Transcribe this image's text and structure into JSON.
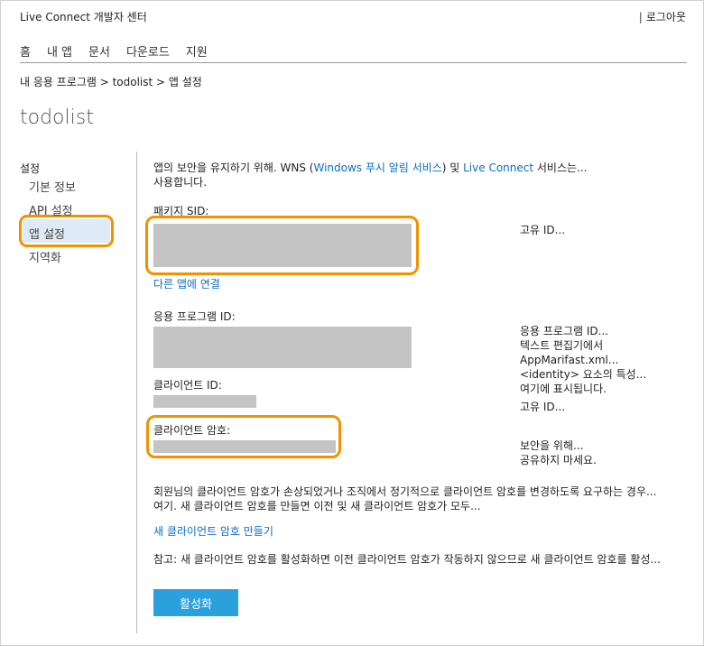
{
  "header": {
    "app_name": "Live Connect 개발자 센터",
    "separator": "|",
    "logout": "로그아웃"
  },
  "nav": [
    "홈",
    "내 앱",
    "문서",
    "다운로드",
    "지원"
  ],
  "breadcrumb": "내 응용 프로그램 > todolist > 앱 설정",
  "page_title": "todolist",
  "sidebar": {
    "heading": "설정",
    "items": [
      "기본 정보",
      "API 설정",
      "앱 설정",
      "지역화"
    ],
    "selected": "앱 설정"
  },
  "main": {
    "intro_before": "앱의 보안을 유지하기 위해. WNS (",
    "intro_link1": "Windows  푸시 알림 서비스",
    "intro_mid": ") 및 ",
    "intro_link2": "Live Connect",
    "intro_after": " 서비스는...",
    "intro_line2": "사용합니다.",
    "package_sid_label": "패키지 SID:",
    "package_sid_desc": "고유 ID...",
    "other_app_link": "다른 앱에 연결",
    "app_id_label": "응용 프로그램 ID:",
    "app_id_desc": [
      "응용 프로그램 ID...",
      "텍스트 편집기에서 AppMarifast.xml...",
      "<identity> 요소의 특성...",
      "여기에 표시됩니다."
    ],
    "client_id_label": "클라이언트 ID:",
    "client_id_desc": "고유 ID...",
    "client_secret_label": "클라이언트 암호:",
    "client_secret_desc": [
      "보안을 위해...",
      "공유하지 마세요."
    ],
    "warning_line1": "회원님의 클라이언트 암호가 손상되었거나 조직에서 정기적으로 클라이언트 암호를 변경하도록 요구하는 경우...",
    "warning_line2": "여기. 새 클라이언트 암호를 만들면 이전 및 새 클라이언트 암호가 모두...",
    "new_secret_link": "새 클라이언트 암호 만들기",
    "note": "참고: 새 클라이언트 암호를 활성화하면 이전 클라이언트 암호가 작동하지 않으므로 새 클라이언트 암호를 활성...",
    "activate_button": "활성화"
  },
  "colors": {
    "highlight": "#f39200",
    "link": "#0c6cc4",
    "button": "#2aa0dd",
    "redacted": "#c4c4c4"
  }
}
